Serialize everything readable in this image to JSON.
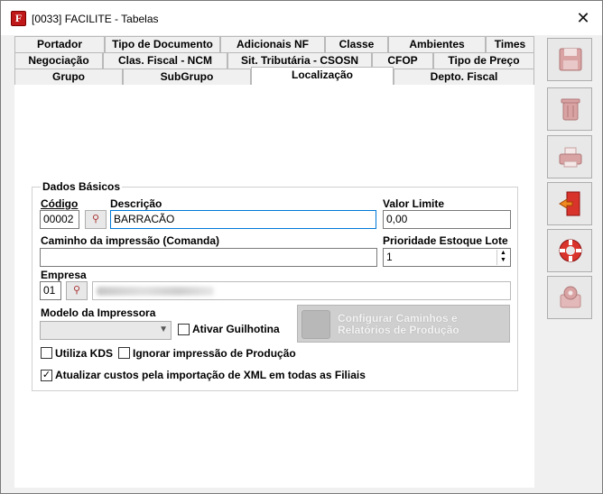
{
  "window": {
    "title": "[0033] FACILITE - Tabelas",
    "app_icon_glyph": "F",
    "close_glyph": "✕"
  },
  "tabs": {
    "row1": [
      "Portador",
      "Tipo de Documento",
      "Adicionais NF",
      "Classe",
      "Ambientes",
      "Times"
    ],
    "row2": [
      "Negociação",
      "Clas. Fiscal - NCM",
      "Sit. Tributária - CSOSN",
      "CFOP",
      "Tipo de Preço"
    ],
    "row3": [
      "Grupo",
      "SubGrupo",
      "Localização",
      "Depto. Fiscal"
    ],
    "active": "Localização"
  },
  "form": {
    "group_title": "Dados Básicos",
    "codigo_label": "Código",
    "codigo_value": "00002",
    "descricao_label": "Descrição",
    "descricao_value": "BARRACÃO",
    "valor_limite_label": "Valor Limite",
    "valor_limite_value": "0,00",
    "caminho_label": "Caminho da impressão (Comanda)",
    "caminho_value": "",
    "prioridade_label": "Prioridade Estoque Lote",
    "prioridade_value": "1",
    "empresa_label": "Empresa",
    "empresa_value": "01",
    "modelo_label": "Modelo da Impressora",
    "modelo_value": "",
    "ativar_guilhotina_label": "Ativar Guilhotina",
    "ativar_guilhotina_checked": false,
    "configurar_button_label_1": "Configurar Caminhos e",
    "configurar_button_label_2": "Relatórios de Produção",
    "utiliza_kds_label": "Utiliza KDS",
    "utiliza_kds_checked": false,
    "ignorar_impressao_label": "Ignorar impressão de Produção",
    "ignorar_impressao_checked": false,
    "atualizar_custos_label": "Atualizar custos pela importação de XML em todas as Filiais",
    "atualizar_custos_checked": true,
    "check_glyph": "✓"
  },
  "sidebar": {
    "buttons": [
      {
        "name": "save",
        "icon": "floppy-disk-icon",
        "enabled": false
      },
      {
        "name": "delete",
        "icon": "trash-can-icon",
        "enabled": false
      },
      {
        "name": "print",
        "icon": "printer-icon",
        "enabled": false
      },
      {
        "name": "exit",
        "icon": "exit-door-icon",
        "enabled": true
      },
      {
        "name": "help",
        "icon": "lifebuoy-icon",
        "enabled": true
      },
      {
        "name": "settings",
        "icon": "gear-icon",
        "enabled": false
      }
    ]
  },
  "colors": {
    "accent_red": "#d9342b",
    "focus_border": "#0078d7",
    "disabled_icon": "#c8a0a0"
  }
}
